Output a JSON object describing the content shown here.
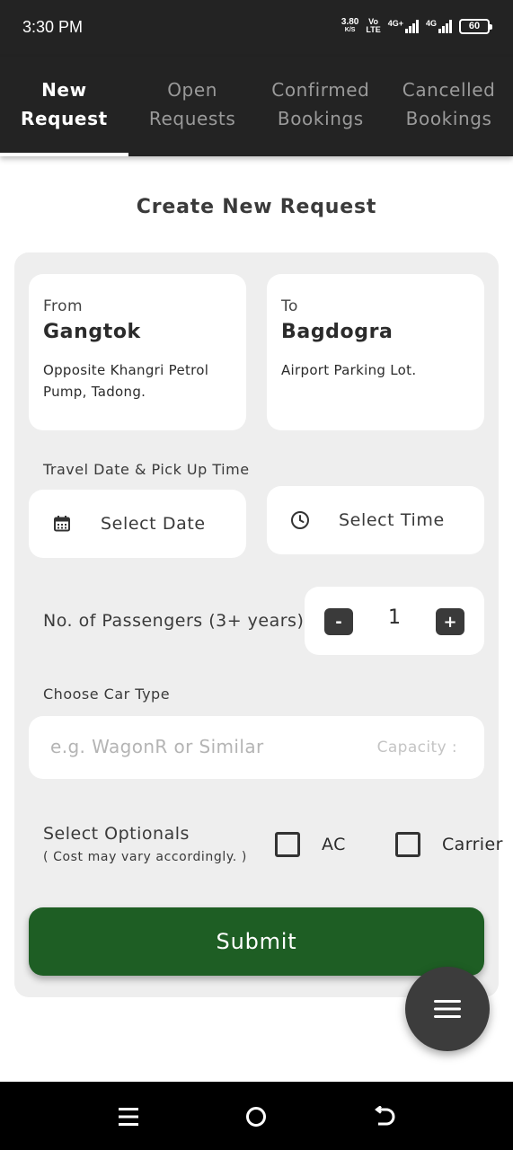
{
  "status_bar": {
    "time": "3:30 PM",
    "net_speed": "3.80",
    "net_speed_unit": "K/S",
    "volte_top": "Vo",
    "volte_bottom": "LTE",
    "sim1_label": "4G+",
    "sim2_label": "4G",
    "battery": "60"
  },
  "tabs": [
    {
      "label": "New\nRequest",
      "active": true
    },
    {
      "label": "Open\nRequests",
      "active": false
    },
    {
      "label": "Confirmed\nBookings",
      "active": false
    },
    {
      "label": "Cancelled\nBookings",
      "active": false
    }
  ],
  "page_title": "Create New Request",
  "from": {
    "label": "From",
    "city": "Gangtok",
    "address": "Opposite Khangri Petrol Pump, Tadong."
  },
  "to": {
    "label": "To",
    "city": "Bagdogra",
    "address": "Airport Parking Lot."
  },
  "travel": {
    "label": "Travel Date & Pick Up Time",
    "date_placeholder": "Select Date",
    "time_placeholder": "Select Time"
  },
  "passengers": {
    "label": "No. of Passengers (3+ years)",
    "minus": "-",
    "value": "1",
    "plus": "+"
  },
  "car": {
    "label": "Choose Car Type",
    "placeholder": "e.g. WagonR or Similar",
    "capacity_label": "Capacity :"
  },
  "optionals": {
    "title": "Select Optionals",
    "subtitle": "( Cost may vary accordingly. )",
    "options": [
      {
        "label": "AC",
        "checked": false
      },
      {
        "label": "Carrier",
        "checked": false
      }
    ]
  },
  "submit_label": "Submit",
  "fab_icon": "menu-icon",
  "nav": {
    "recent": "recent-apps-icon",
    "home": "home-icon",
    "back": "back-icon"
  },
  "colors": {
    "header_bg": "#232323",
    "submit_green": "#1e5e24",
    "panel_bg": "#eeeeee"
  }
}
